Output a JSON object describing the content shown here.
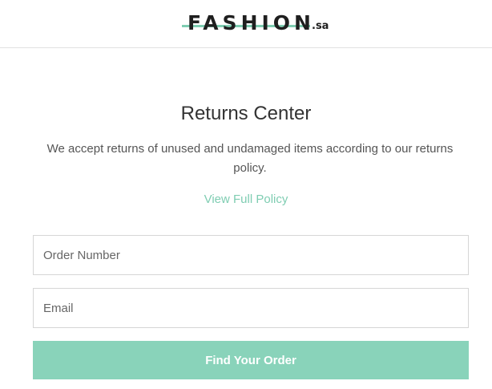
{
  "header": {
    "logo_main": "FASHION",
    "logo_suffix": ".sa"
  },
  "returns": {
    "title": "Returns Center",
    "description": "We accept returns of unused and undamaged items according to our returns policy.",
    "policy_link": "View Full Policy"
  },
  "form": {
    "order_placeholder": "Order Number",
    "email_placeholder": "Email",
    "submit_label": "Find Your Order"
  },
  "colors": {
    "accent": "#89d3ba",
    "link": "#7fcdb2",
    "text": "#333333"
  }
}
